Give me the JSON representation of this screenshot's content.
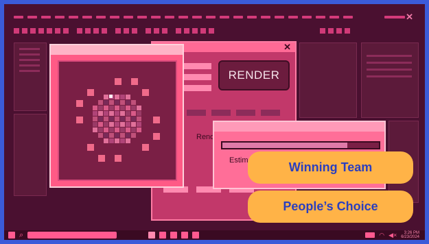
{
  "background_color": "#3b5bd9",
  "accent_color": "#ff5a86",
  "window": {
    "close_glyph": "✕"
  },
  "render_dialog": {
    "close_glyph": "✕",
    "render_button_label": "RENDER",
    "render_label_partial": "Rend"
  },
  "progress_dialog": {
    "estimate_label_partial": "Estima",
    "progress_fraction": 0.8
  },
  "taskbar": {
    "clock_time": "3:26 PM",
    "clock_date": "6/23/2024"
  },
  "badges": {
    "winning_team": "Winning Team",
    "peoples_choice": "People’s Choice"
  }
}
